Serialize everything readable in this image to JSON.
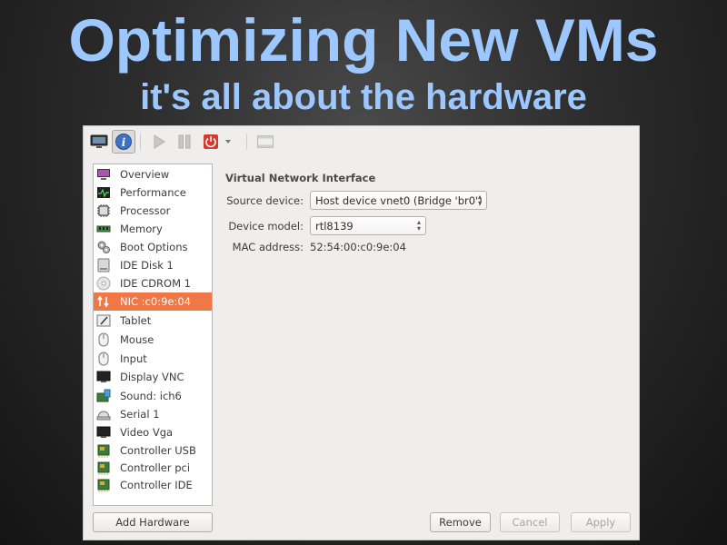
{
  "slide": {
    "title": "Optimizing New VMs",
    "subtitle": "it's all about the hardware"
  },
  "toolbar": {
    "buttons": [
      "console-icon",
      "info-icon",
      "run-icon",
      "pause-icon",
      "shutdown-icon",
      "dropdown-icon",
      "fullscreen-icon"
    ],
    "active": "info-icon"
  },
  "sidebar": {
    "selected_index": 7,
    "items": [
      {
        "label": "Overview",
        "icon": "overview-icon"
      },
      {
        "label": "Performance",
        "icon": "performance-icon"
      },
      {
        "label": "Processor",
        "icon": "processor-icon"
      },
      {
        "label": "Memory",
        "icon": "memory-icon"
      },
      {
        "label": "Boot Options",
        "icon": "boot-options-icon"
      },
      {
        "label": "IDE Disk 1",
        "icon": "disk-icon"
      },
      {
        "label": "IDE CDROM 1",
        "icon": "cdrom-icon"
      },
      {
        "label": "NIC :c0:9e:04",
        "icon": "nic-icon"
      },
      {
        "label": "Tablet",
        "icon": "tablet-icon"
      },
      {
        "label": "Mouse",
        "icon": "mouse-icon"
      },
      {
        "label": "Input",
        "icon": "input-icon"
      },
      {
        "label": "Display VNC",
        "icon": "display-icon"
      },
      {
        "label": "Sound: ich6",
        "icon": "sound-icon"
      },
      {
        "label": "Serial 1",
        "icon": "serial-icon"
      },
      {
        "label": "Video Vga",
        "icon": "video-icon"
      },
      {
        "label": "Controller USB",
        "icon": "controller-icon"
      },
      {
        "label": "Controller pci",
        "icon": "controller-icon"
      },
      {
        "label": "Controller IDE",
        "icon": "controller-icon"
      }
    ]
  },
  "details": {
    "heading": "Virtual Network Interface",
    "source_device_label": "Source device:",
    "source_device_value": "Host device vnet0 (Bridge 'br0')",
    "device_model_label": "Device model:",
    "device_model_value": "rtl8139",
    "mac_label": "MAC address:",
    "mac_value": "52:54:00:c0:9e:04"
  },
  "buttons": {
    "add_hardware": "Add Hardware",
    "remove": "Remove",
    "cancel": "Cancel",
    "apply": "Apply"
  },
  "colors": {
    "title": "#9cc8ff",
    "selection": "#f07746"
  }
}
